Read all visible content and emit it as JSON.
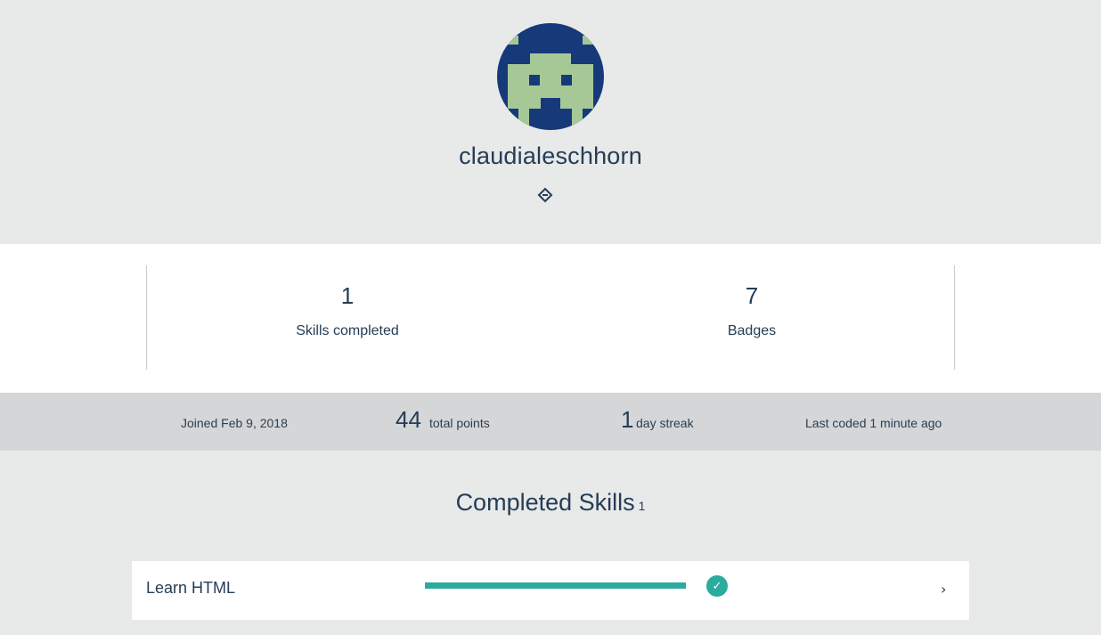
{
  "profile": {
    "username": "claudialeschhorn",
    "avatar_icon": "pixel-alien-avatar",
    "link_icon": "share-link-icon"
  },
  "stats": [
    {
      "value": "1",
      "label": "Skills completed"
    },
    {
      "value": "7",
      "label": "Badges"
    }
  ],
  "info": {
    "joined": "Joined Feb 9, 2018",
    "points_value": "44",
    "points_label": "total points",
    "streak_value": "1",
    "streak_label": "day streak",
    "last_coded": "Last coded 1 minute ago"
  },
  "completed": {
    "title": "Completed Skills",
    "count": "1",
    "skills": [
      {
        "name": "Learn HTML",
        "progress": 1.0,
        "status": "complete",
        "icon": "checkmark-icon",
        "chevron": "›"
      }
    ]
  },
  "colors": {
    "page_bg": "#e8e9e9",
    "text": "#253d56",
    "avatar_bg": "#16397a",
    "avatar_fg": "#a6c897",
    "accent": "#2bab9e",
    "info_band": "#d4d6d8"
  }
}
